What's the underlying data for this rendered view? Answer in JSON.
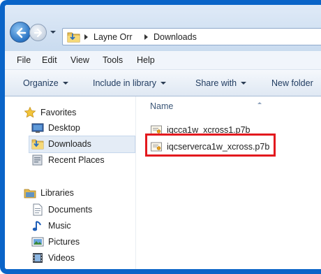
{
  "address": {
    "crumbs": [
      "Layne Orr",
      "Downloads"
    ]
  },
  "menu": [
    "File",
    "Edit",
    "View",
    "Tools",
    "Help"
  ],
  "toolbar": {
    "organize": "Organize",
    "include": "Include in library",
    "share": "Share with",
    "newfolder": "New folder"
  },
  "nav": {
    "favorites": "Favorites",
    "desktop": "Desktop",
    "downloads": "Downloads",
    "recent": "Recent Places",
    "libraries": "Libraries",
    "documents": "Documents",
    "music": "Music",
    "pictures": "Pictures",
    "videos": "Videos"
  },
  "files": {
    "column_name": "Name",
    "items": [
      "iqcca1w_xcross1.p7b",
      "iqcserverca1w_xcross.p7b"
    ]
  },
  "colors": {
    "frame_border": "#0a64c8",
    "highlight": "#e3191e"
  },
  "icons": [
    "back-arrow-icon",
    "forward-arrow-icon",
    "folder-icon",
    "star-icon",
    "desktop-icon",
    "downloads-folder-icon",
    "recent-places-icon",
    "libraries-icon",
    "documents-icon",
    "music-icon",
    "pictures-icon",
    "videos-icon",
    "certificate-file-icon"
  ]
}
